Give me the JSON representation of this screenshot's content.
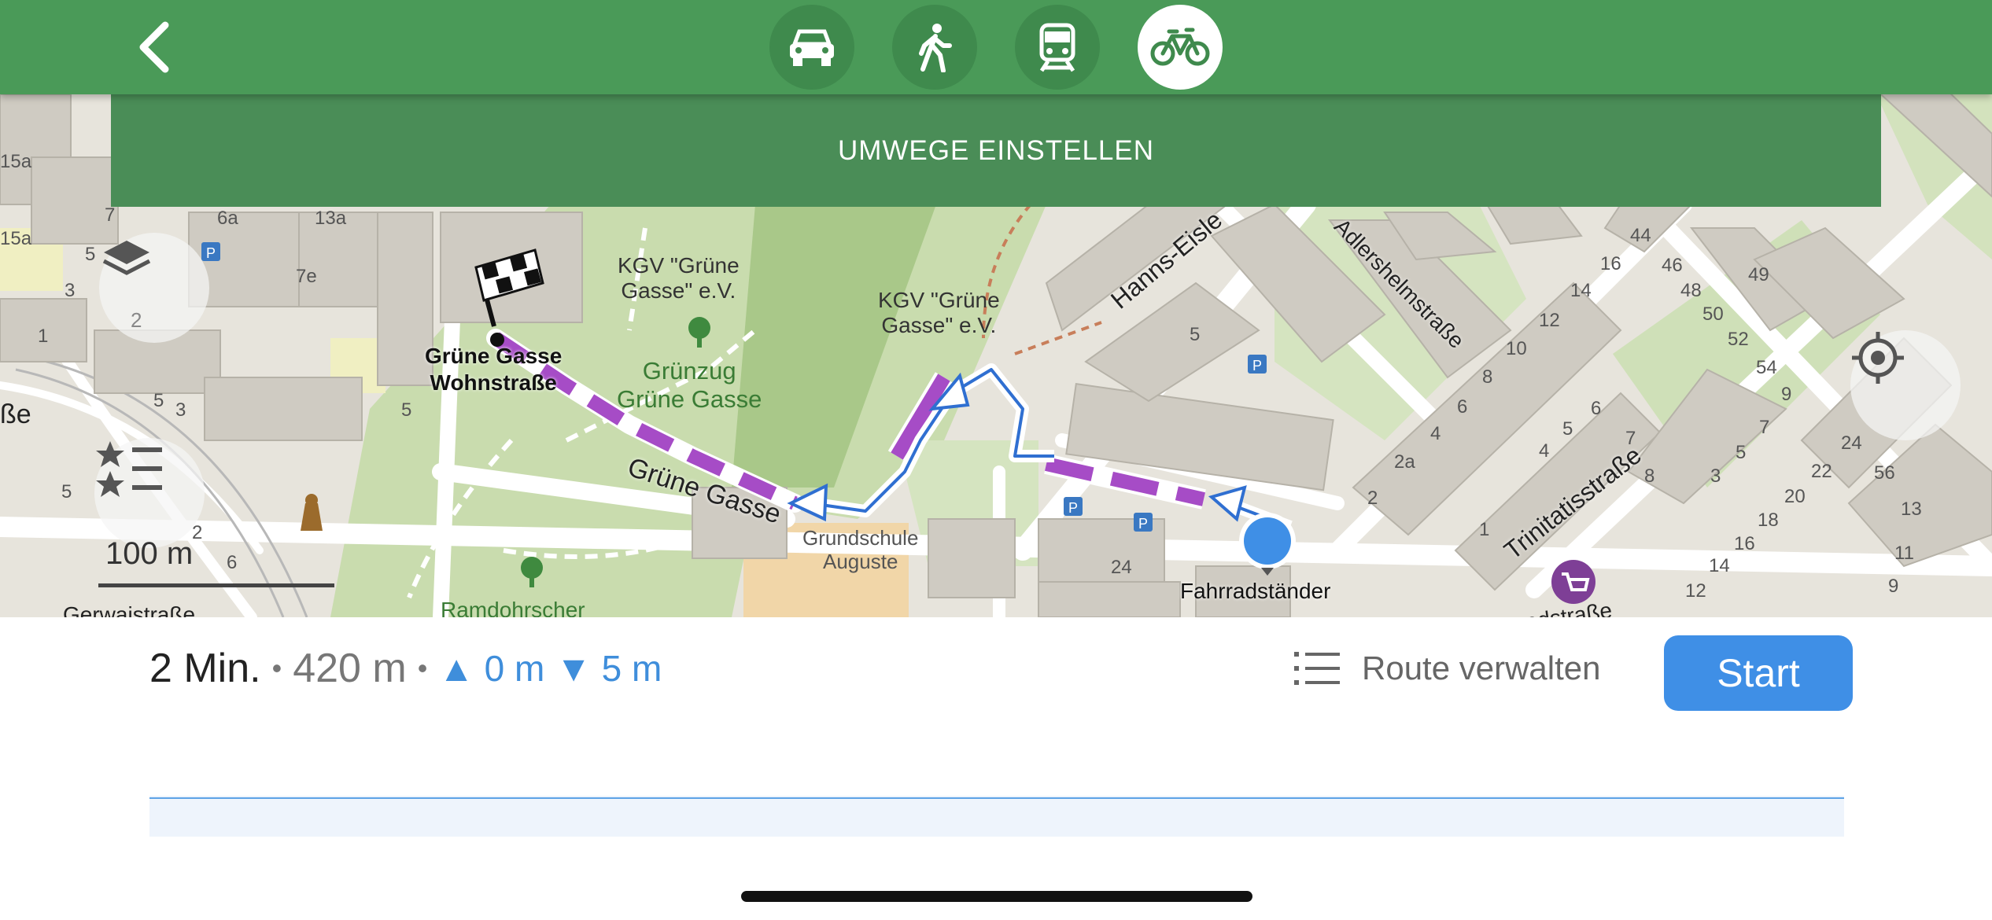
{
  "header": {
    "back_icon": "chevron-left-icon",
    "modes": [
      {
        "name": "car",
        "icon": "car-icon",
        "active": false
      },
      {
        "name": "walk",
        "icon": "walk-icon",
        "active": false
      },
      {
        "name": "transit",
        "icon": "train-icon",
        "active": false
      },
      {
        "name": "bicycle",
        "icon": "bicycle-icon",
        "active": true
      }
    ]
  },
  "detour_banner": {
    "label": "UMWEGE EINSTELLEN"
  },
  "map": {
    "labels": {
      "destination": "Grüne Gasse\nWohnstraße",
      "kgv1": "KGV \"Grüne\nGasse\" e.V.",
      "kgv2": "KGV \"Grüne\nGasse\" e.V.",
      "gruenzug": "Grünzug\nGrüne Gasse",
      "street_gruene": "Grüne Gasse",
      "street_hanns": "Hanns-Eisle",
      "street_adlershelm": "Adlershelmstraße",
      "street_trinitatis": "Trinitatisstraße",
      "school": "Grundschule\nAuguste",
      "bike_stand": "Fahrradständer",
      "ramdohrscher": "Ramdohrscher",
      "left_edge": "ße",
      "bottom_left": "Gerwaistraße",
      "bottom_right": "Konradstraße"
    },
    "house_numbers": [
      "15a",
      "7",
      "6a",
      "13a",
      "15a",
      "5",
      "7e",
      "3",
      "1",
      "5",
      "3",
      "5",
      "5",
      "2",
      "6",
      "8",
      "2",
      "5",
      "44",
      "16",
      "46",
      "14",
      "48",
      "12",
      "50",
      "49",
      "10",
      "52",
      "8",
      "54",
      "6",
      "9",
      "4",
      "5",
      "7",
      "2a",
      "6",
      "5",
      "4",
      "7",
      "2",
      "8",
      "3",
      "24",
      "1",
      "22",
      "56",
      "20",
      "13",
      "18",
      "16",
      "11",
      "14",
      "9",
      "12",
      "24"
    ],
    "layers_count": "2",
    "scale": "100 m",
    "icons": [
      "layers-icon",
      "favorites-list-icon",
      "my-location-icon",
      "finish-flag-icon",
      "user-location-icon",
      "parking-icon",
      "shopping-cart-icon",
      "tree-icon",
      "monument-icon"
    ]
  },
  "summary": {
    "time": "2 Min.",
    "separator": "•",
    "distance": "420 m",
    "ascent": "▲ 0 m",
    "descent": "▼ 5 m"
  },
  "actions": {
    "route_manage_icon": "list-icon",
    "route_manage": "Route verwalten",
    "start": "Start"
  },
  "colors": {
    "header_green": "#4a9a58",
    "route_purple": "#a64cc6",
    "start_blue": "#3f8fe6",
    "elevation_line": "#5ea3e6"
  }
}
